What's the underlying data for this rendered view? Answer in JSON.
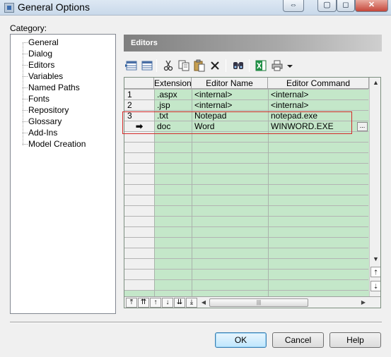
{
  "window": {
    "title": "General Options",
    "restore_glyph": "⇔",
    "minimize_glyph": "▢",
    "maximize_glyph": "◻",
    "close_glyph": "✕"
  },
  "category": {
    "label": "Category:",
    "items": [
      {
        "label": "General"
      },
      {
        "label": "Dialog"
      },
      {
        "label": "Editors"
      },
      {
        "label": "Variables"
      },
      {
        "label": "Named Paths"
      },
      {
        "label": "Fonts"
      },
      {
        "label": "Repository"
      },
      {
        "label": "Glossary"
      },
      {
        "label": "Add-Ins"
      },
      {
        "label": "Model Creation"
      }
    ]
  },
  "panel": {
    "title": "Editors"
  },
  "toolbar": {
    "icons": [
      "insert-row-icon",
      "add-row-icon",
      "cut-icon",
      "copy-icon",
      "paste-icon",
      "delete-icon",
      "find-icon",
      "excel-export-icon",
      "print-icon",
      "dropdown-arrow-icon"
    ]
  },
  "grid": {
    "columns": [
      "Extension",
      "Editor Name",
      "Editor Command"
    ],
    "rows": [
      {
        "num": "1",
        "extension": ".aspx",
        "editor_name": "<internal>",
        "editor_command": "<internal>"
      },
      {
        "num": "2",
        "extension": ".jsp",
        "editor_name": "<internal>",
        "editor_command": "<internal>"
      },
      {
        "num": "3",
        "extension": ".txt",
        "editor_name": "Notepad",
        "editor_command": "notepad.exe"
      },
      {
        "num": "➡",
        "extension": "doc",
        "editor_name": "Word",
        "editor_command": "WINWORD.EXE"
      }
    ],
    "ellipsis": "...",
    "grip": "|||"
  },
  "nav_buttons": [
    "⤒",
    "⇈",
    "↑",
    "↓",
    "⇊",
    "⤓"
  ],
  "buttons": {
    "ok": "OK",
    "cancel": "Cancel",
    "help": "Help"
  }
}
